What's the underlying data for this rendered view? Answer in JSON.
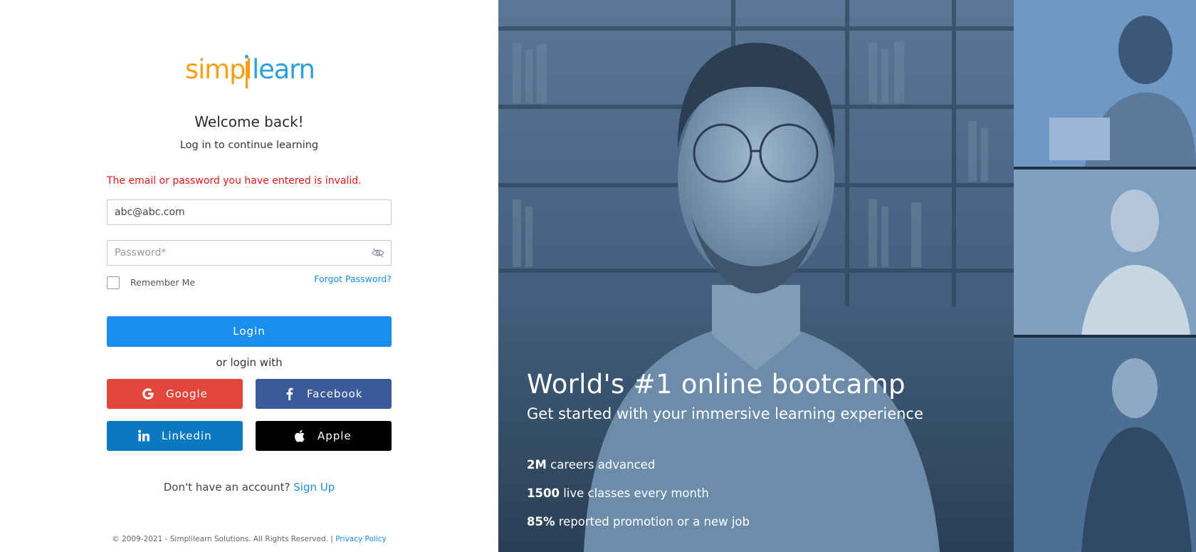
{
  "brand": {
    "logo_part1": "simpl",
    "logo_part2": "learn",
    "colors": {
      "orange": "#f6a01a",
      "blue": "#2aa1d8"
    }
  },
  "login": {
    "heading": "Welcome back!",
    "subheading": "Log in to continue learning",
    "error": "The email or password you have entered is invalid.",
    "email_value": "abc@abc.com",
    "password_placeholder": "Password*",
    "remember_label": "Remember Me",
    "forgot_label": "Forgot Password?",
    "login_button": "Login",
    "or_text": "or login with",
    "social": {
      "google": "Google",
      "facebook": "Facebook",
      "linkedin": "Linkedin",
      "apple": "Apple"
    },
    "signup_prompt": "Don't have an account?",
    "signup_link": "Sign Up",
    "footer_text": "© 2009-2021 - Simplilearn Solutions. All Rights Reserved. |",
    "footer_link": "Privacy Policy"
  },
  "hero": {
    "headline": "World's #1 online bootcamp",
    "tagline": "Get started with your immersive learning experience",
    "stats": [
      {
        "value": "2M",
        "label": "careers advanced"
      },
      {
        "value": "1500",
        "label": "live classes every month"
      },
      {
        "value": "85%",
        "label": "reported promotion or a new job"
      }
    ]
  },
  "colors": {
    "accent": "#1a8ded",
    "error": "#e4161b",
    "google": "#e2463a",
    "facebook": "#3b5a9a",
    "linkedin": "#0a79bf",
    "apple": "#000000"
  }
}
